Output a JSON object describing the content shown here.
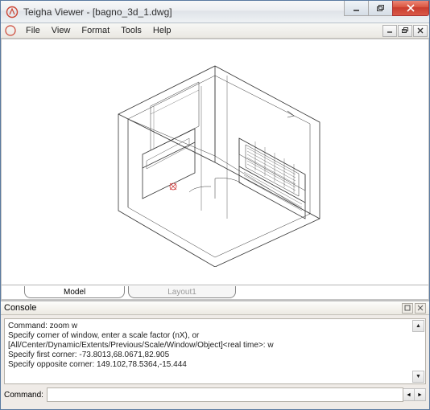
{
  "window": {
    "title": "Teigha Viewer - [bagno_3d_1.dwg]"
  },
  "menu": {
    "file": "File",
    "view": "View",
    "format": "Format",
    "tools": "Tools",
    "help": "Help"
  },
  "tabs": {
    "model": "Model",
    "layout1": "Layout1"
  },
  "console": {
    "title": "Console",
    "line1": "Command: zoom w",
    "line2": "Specify corner of window, enter a scale factor (nX), or",
    "line3": "[All/Center/Dynamic/Extents/Previous/Scale/Window/Object]<real time>: w",
    "line4": "Specify first corner: -73.8013,68.0671,82.905",
    "line5": "Specify opposite corner: 149.102,78.5364,-15.444"
  },
  "command": {
    "label": "Command:",
    "value": ""
  }
}
